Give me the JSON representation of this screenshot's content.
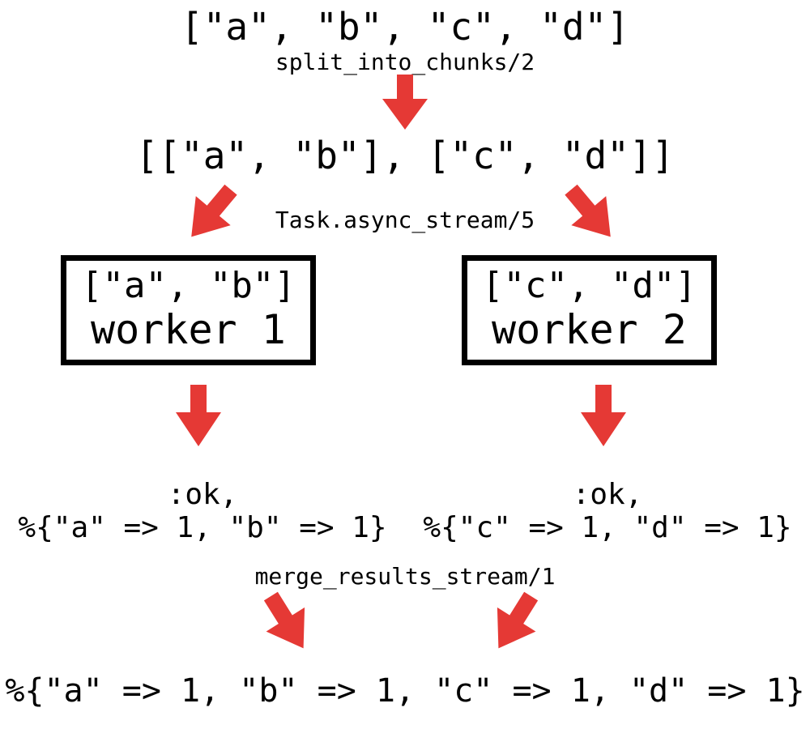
{
  "chart_data": {
    "type": "diagram",
    "title": "",
    "nodes": [
      {
        "id": "input",
        "text": "[\"a\", \"b\", \"c\", \"d\"]"
      },
      {
        "id": "chunks",
        "text": "[[\"a\", \"b\"], [\"c\", \"d\"]]"
      },
      {
        "id": "worker1",
        "chunk": "[\"a\", \"b\"]",
        "title": "worker 1"
      },
      {
        "id": "worker2",
        "chunk": "[\"c\", \"d\"]",
        "title": "worker 2"
      },
      {
        "id": "result1",
        "ok": ":ok,",
        "map": "%{\"a\" => 1, \"b\" => 1}"
      },
      {
        "id": "result2",
        "ok": ":ok,",
        "map": "%{\"c\" => 1, \"d\" => 1}"
      },
      {
        "id": "final",
        "text": "%{\"a\" => 1, \"b\" => 1, \"c\" => 1, \"d\" => 1}"
      }
    ],
    "edge_labels": {
      "split": "split_into_chunks/2",
      "async": "Task.async_stream/5",
      "merge": "merge_results_stream/1"
    },
    "edges": [
      [
        "input",
        "chunks",
        "split"
      ],
      [
        "chunks",
        "worker1",
        "async"
      ],
      [
        "chunks",
        "worker2",
        "async"
      ],
      [
        "worker1",
        "result1",
        null
      ],
      [
        "worker2",
        "result2",
        null
      ],
      [
        "result1",
        "final",
        "merge"
      ],
      [
        "result2",
        "final",
        "merge"
      ]
    ],
    "arrow_color": "#e53935"
  }
}
